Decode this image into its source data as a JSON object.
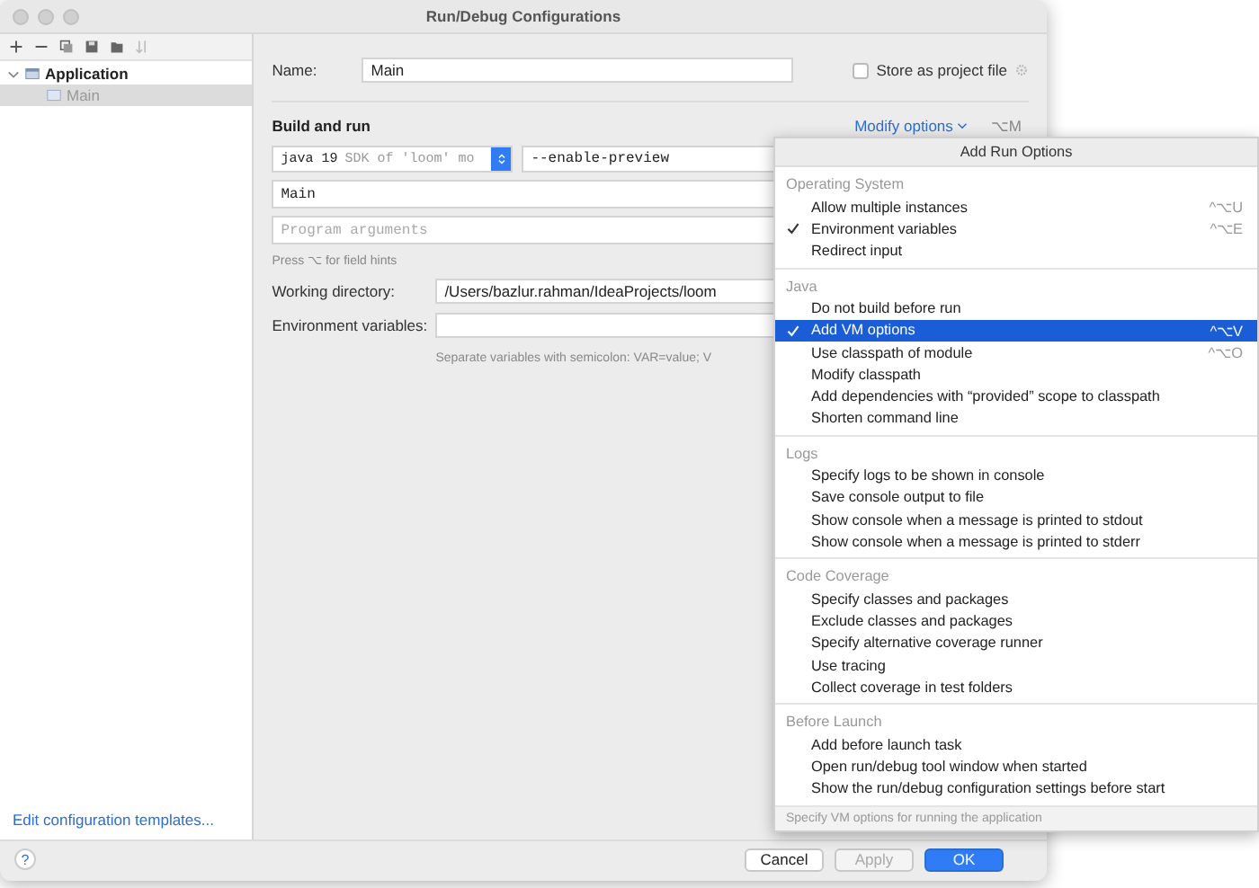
{
  "window": {
    "title": "Run/Debug Configurations"
  },
  "sidebar": {
    "tree": [
      {
        "label": "Application",
        "expanded": true,
        "selected": false,
        "children": [
          {
            "label": "Main",
            "selected": true
          }
        ]
      }
    ],
    "templates_link": "Edit configuration templates..."
  },
  "form": {
    "name": {
      "label": "Name:",
      "value": "Main"
    },
    "store_as_project_file": {
      "label": "Store as project file",
      "checked": false
    },
    "section_title": "Build and run",
    "modify_options": {
      "label": "Modify options",
      "shortcut": "⌥M"
    },
    "jre": {
      "value": "java 19",
      "hint": "SDK of 'loom' mo"
    },
    "vm_options": {
      "value": "--enable-preview"
    },
    "main_class": {
      "value": "Main"
    },
    "program_arguments": {
      "placeholder": "Program arguments"
    },
    "field_hint": "Press ⌥ for field hints",
    "working_directory": {
      "label": "Working directory:",
      "value": "/Users/bazlur.rahman/IdeaProjects/loom"
    },
    "environment_variables": {
      "label": "Environment variables:"
    },
    "env_hint": "Separate variables with semicolon: VAR=value; V"
  },
  "popup": {
    "title": "Add Run Options",
    "sections": [
      {
        "title": "Operating System",
        "items": [
          {
            "label": "Allow multiple instances",
            "shortcut": "^⌥U",
            "checked": false,
            "selected": false
          },
          {
            "label": "Environment variables",
            "shortcut": "^⌥E",
            "checked": true,
            "selected": false
          },
          {
            "label": "Redirect input",
            "checked": false,
            "selected": false
          }
        ]
      },
      {
        "title": "Java",
        "items": [
          {
            "label": "Do not build before run",
            "checked": false,
            "selected": false
          },
          {
            "label": "Add VM options",
            "shortcut": "^⌥V",
            "checked": true,
            "selected": true
          },
          {
            "label": "Use classpath of module",
            "shortcut": "^⌥O",
            "checked": false,
            "selected": false
          },
          {
            "label": "Modify classpath",
            "checked": false,
            "selected": false
          },
          {
            "label": "Add dependencies with “provided” scope to classpath",
            "checked": false,
            "selected": false
          },
          {
            "label": "Shorten command line",
            "checked": false,
            "selected": false
          }
        ]
      },
      {
        "title": "Logs",
        "items": [
          {
            "label": "Specify logs to be shown in console",
            "checked": false,
            "selected": false
          },
          {
            "label": "Save console output to file",
            "checked": false,
            "selected": false
          },
          {
            "label": "Show console when a message is printed to stdout",
            "checked": false,
            "selected": false
          },
          {
            "label": "Show console when a message is printed to stderr",
            "checked": false,
            "selected": false
          }
        ]
      },
      {
        "title": "Code Coverage",
        "items": [
          {
            "label": "Specify classes and packages",
            "checked": false,
            "selected": false
          },
          {
            "label": "Exclude classes and packages",
            "checked": false,
            "selected": false
          },
          {
            "label": "Specify alternative coverage runner",
            "checked": false,
            "selected": false
          },
          {
            "label": "Use tracing",
            "checked": false,
            "selected": false
          },
          {
            "label": "Collect coverage in test folders",
            "checked": false,
            "selected": false
          }
        ]
      },
      {
        "title": "Before Launch",
        "items": [
          {
            "label": "Add before launch task",
            "checked": false,
            "selected": false
          },
          {
            "label": "Open run/debug tool window when started",
            "checked": false,
            "selected": false
          },
          {
            "label": "Show the run/debug configuration settings before start",
            "checked": false,
            "selected": false
          }
        ]
      }
    ],
    "footer": "Specify VM options for running the application"
  },
  "help": "?",
  "buttons": [
    {
      "label": "Cancel",
      "kind": "normal",
      "disabled": false
    },
    {
      "label": "Apply",
      "kind": "normal",
      "disabled": true
    },
    {
      "label": "OK",
      "kind": "primary",
      "disabled": false
    }
  ]
}
